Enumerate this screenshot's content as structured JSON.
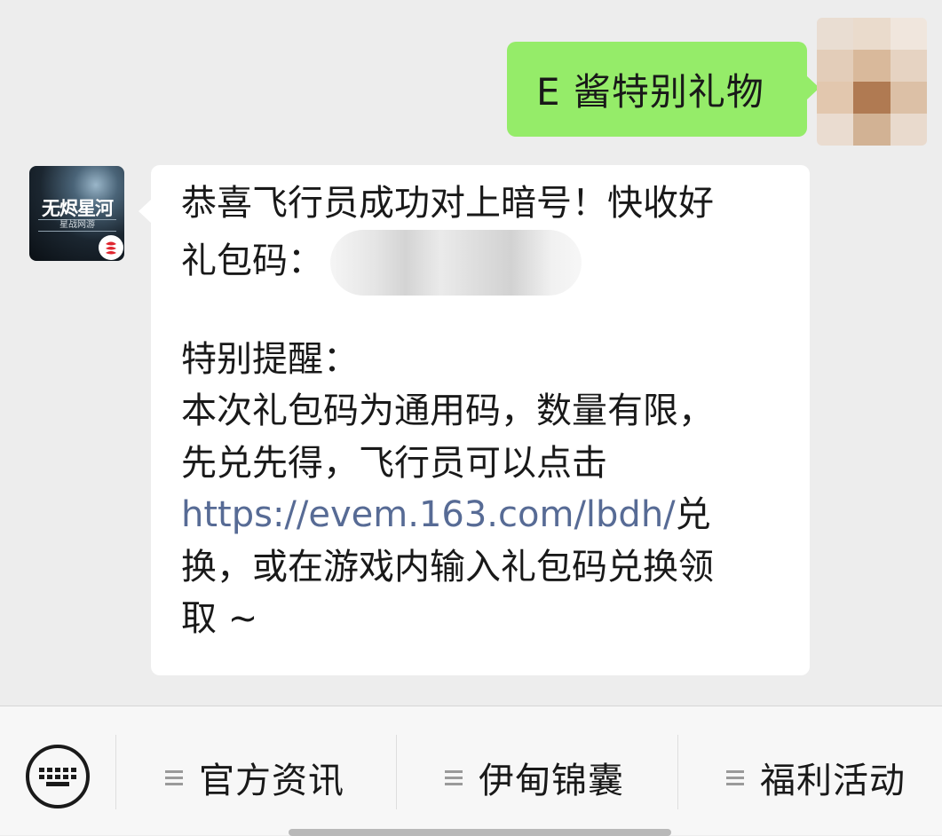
{
  "chat": {
    "outgoing_message": "E 酱特别礼物",
    "incoming_avatar": {
      "logo_text": "无烬星河",
      "logo_sub": "星战网游"
    },
    "incoming_message": {
      "line1": "恭喜飞行员成功对上暗号！快收好",
      "line2_prefix": "礼包码：",
      "line3": "特别提醒：",
      "line4": "本次礼包码为通用码，数量有限，",
      "line5": "先兑先得，飞行员可以点击",
      "link": "https://evem.163.com/lbdh/",
      "line6_suffix": "兑",
      "line7": "换，或在游戏内输入礼包码兑换领",
      "line8": "取 ~"
    }
  },
  "menu": {
    "items": [
      {
        "label": "官方资讯"
      },
      {
        "label": "伊甸锦囊"
      },
      {
        "label": "福利活动"
      }
    ]
  },
  "colors": {
    "outgoing_bubble": "#95ec69",
    "link": "#576b95",
    "background": "#ededed"
  }
}
